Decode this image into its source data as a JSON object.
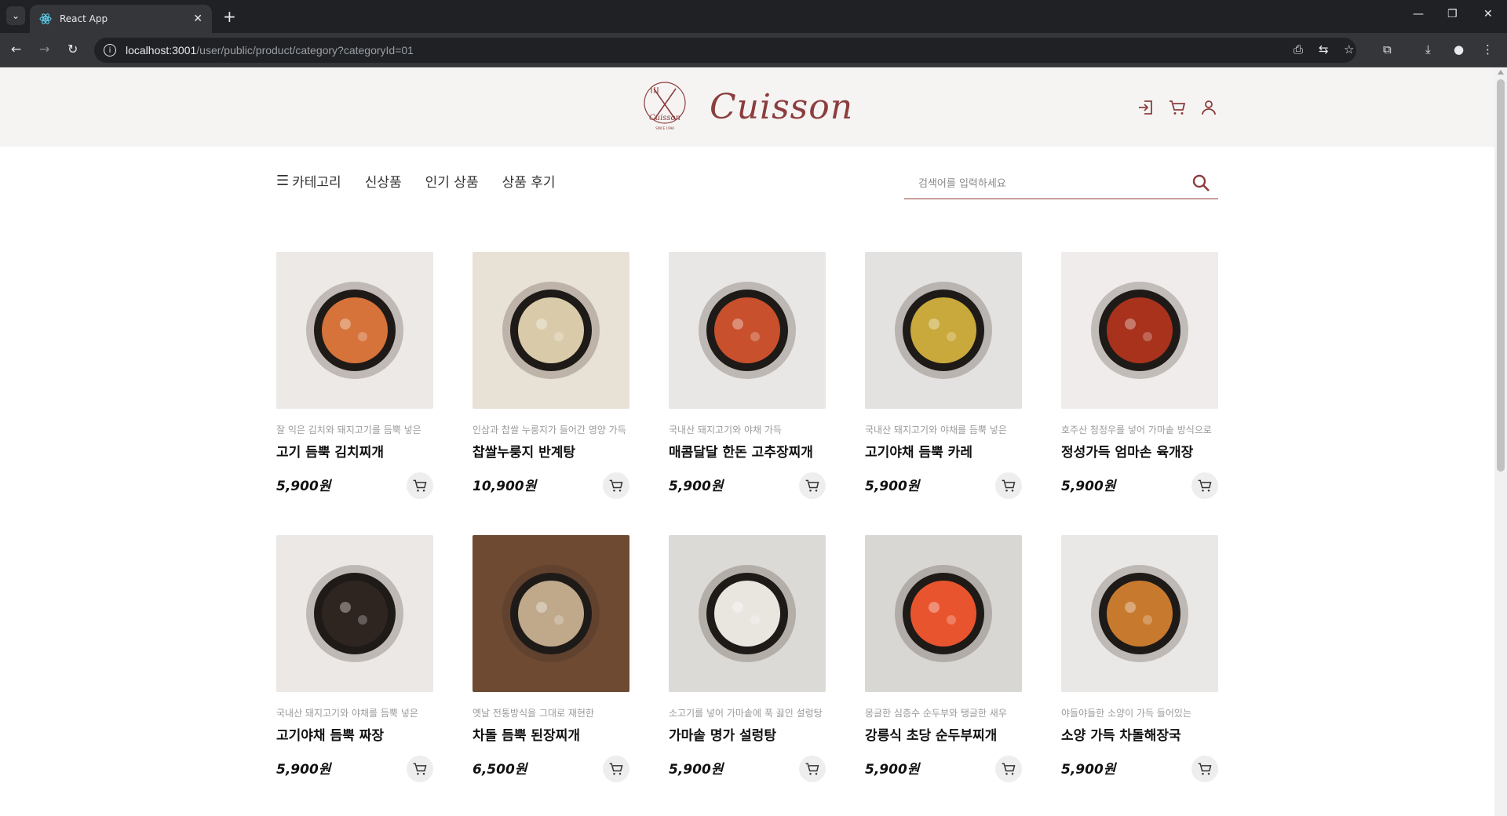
{
  "browser": {
    "tab_title": "React App",
    "url_host": "localhost:3001",
    "url_path": "/user/public/product/category?categoryId=01"
  },
  "header": {
    "logo_text": "Cuisson",
    "brand_color": "#8c3d3d"
  },
  "nav": {
    "category_label": "카테고리",
    "new_label": "신상품",
    "popular_label": "인기 상품",
    "review_label": "상품 후기"
  },
  "search": {
    "placeholder": "검색어를 입력하세요",
    "value": ""
  },
  "products": [
    {
      "desc": "잘 익은 김치와 돼지고기를 듬뿍 넣은",
      "name": "고기 듬뿍 김치찌개",
      "price": "5,900원",
      "colors": [
        "#ece9e6",
        "#d6733a"
      ]
    },
    {
      "desc": "인삼과 찹쌀 누룽지가 들어간 영양 가득",
      "name": "찹쌀누룽지 반계탕",
      "price": "10,900원",
      "colors": [
        "#e8e1d6",
        "#d9cba9"
      ]
    },
    {
      "desc": "국내산 돼지고기와 야채 가득",
      "name": "매콤달달 한돈 고추장찌개",
      "price": "5,900원",
      "colors": [
        "#e9e7e5",
        "#c8502c"
      ]
    },
    {
      "desc": "국내산 돼지고기와 야채를 듬뿍 넣은",
      "name": "고기야채 듬뿍 카레",
      "price": "5,900원",
      "colors": [
        "#e4e2e0",
        "#c9a93c"
      ]
    },
    {
      "desc": "호주산 청정우를 넣어 가마솥 방식으로",
      "name": "정성가득 엄마손 육개장",
      "price": "5,900원",
      "colors": [
        "#efeceb",
        "#a8321c"
      ]
    },
    {
      "desc": "국내산 돼지고기와 야채를 듬뿍 넣은",
      "name": "고기야채 듬뿍 짜장",
      "price": "5,900원",
      "colors": [
        "#ebe8e6",
        "#2e2420"
      ]
    },
    {
      "desc": "옛날 전통방식을 그대로 재현한",
      "name": "차돌 듬뿍 된장찌개",
      "price": "6,500원",
      "colors": [
        "#6e4a33",
        "#bfa98a"
      ]
    },
    {
      "desc": "소고기를 넣어 가마솥에 푹 끓인 설렁탕",
      "name": "가마솥 명가 설렁탕",
      "price": "5,900원",
      "colors": [
        "#dcdad6",
        "#e9e6e0"
      ]
    },
    {
      "desc": "몽글한 심층수 순두부와 탱글한 새우",
      "name": "강릉식 초당 순두부찌개",
      "price": "5,900원",
      "colors": [
        "#d9d7d4",
        "#e8542e"
      ]
    },
    {
      "desc": "야들야들한 소양이 가득 들어있는",
      "name": "소양 가득 차돌해장국",
      "price": "5,900원",
      "colors": [
        "#eae8e6",
        "#c77a2e"
      ]
    }
  ]
}
